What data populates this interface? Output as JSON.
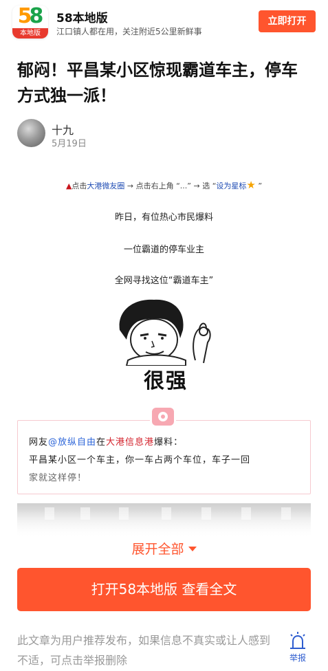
{
  "header": {
    "logo_number": "58",
    "logo_ribbon": "本地版",
    "app_name": "58本地版",
    "app_subtitle": "江口镇人都在用，关注附近5公里新鲜事",
    "open_button": "立即打开"
  },
  "article": {
    "title": "郁闷！平昌某小区惊现霸道车主，停车方式独一派！",
    "author": "十九",
    "date": "5月19日",
    "follow_tip": {
      "marker": "▲",
      "part1": "点击",
      "link1": "大港微友圈",
      "part2": " → 点击右上角 “...” → 选 “",
      "link2": "设为星标",
      "star": "★",
      "part3": " ”"
    },
    "paragraphs": [
      "昨日，有位热心市民爆料",
      "一位霸道的停车业主",
      "全网寻找这位“霸道车主”"
    ],
    "meme_caption": "很强",
    "quote": {
      "prefix": "网友",
      "user": "@放纵自由",
      "mid": "在",
      "source": "大港信息港",
      "suffix": "爆料：",
      "line2": "平昌某小区一个车主，你一车占两个车位，车子一回",
      "line3": "家就这样停！"
    }
  },
  "actions": {
    "expand": "展开全部",
    "open_full": "打开58本地版 查看全文"
  },
  "footer": {
    "disclaimer": "此文章为用户推荐发布，如果信息不真实或让人感到不适，可点击举报删除",
    "report": "举报"
  },
  "colors": {
    "brand_orange": "#ff552e",
    "link_blue": "#2a63d8",
    "highlight_red": "#d3202a"
  }
}
